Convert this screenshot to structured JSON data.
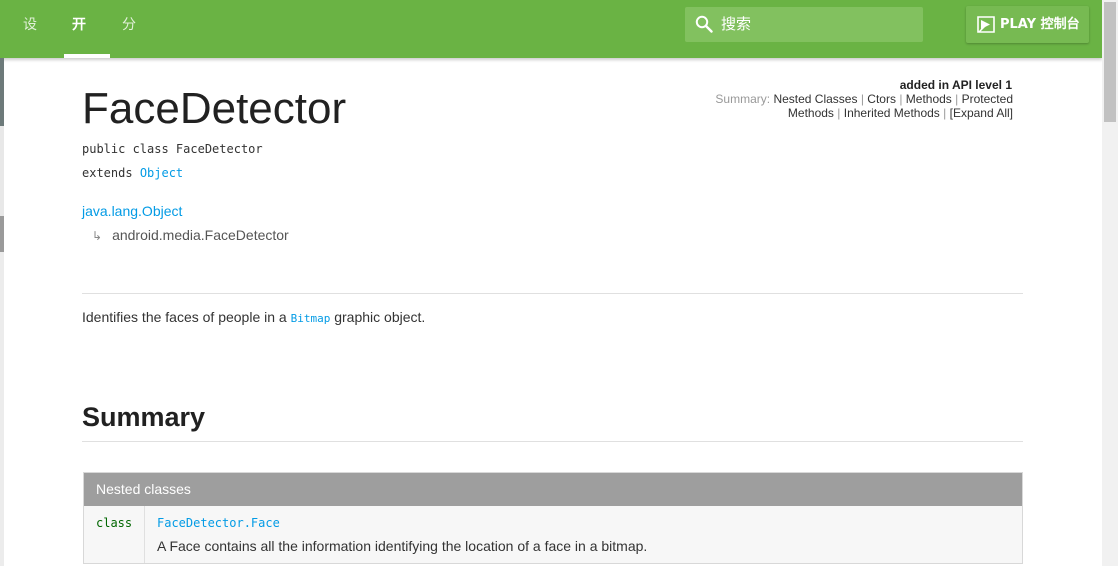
{
  "colors": {
    "header_green": "#6ab344",
    "link_blue": "#039be5"
  },
  "nav": {
    "items": [
      "设计",
      "开发",
      "分发"
    ],
    "active": "开发"
  },
  "search": {
    "placeholder": "搜索",
    "icon": "search-icon"
  },
  "play_button": {
    "label": "PLAY 控制台",
    "icon": "play-console-icon"
  },
  "meta": {
    "api_level": "added in API level 1",
    "summary_prefix": "Summary:",
    "summary_links": [
      "Nested Classes",
      "Ctors",
      "Methods",
      "Protected Methods",
      "Inherited Methods",
      "[Expand All]"
    ]
  },
  "page": {
    "title": "FaceDetector",
    "declaration": "public class FaceDetector",
    "extends_keyword": "extends",
    "extends_class": "Object",
    "hierarchy": [
      "java.lang.Object",
      "android.media.FaceDetector"
    ],
    "hierarchy_arrow": "↳",
    "description_before": "Identifies the faces of people in a",
    "description_code": "Bitmap",
    "description_after": "graphic object."
  },
  "summary": {
    "heading": "Summary",
    "table": {
      "header": "Nested classes",
      "rows": [
        {
          "type": "class",
          "name": "FaceDetector.Face",
          "description": "A Face contains all the information identifying the location of a face in a bitmap."
        }
      ]
    }
  }
}
